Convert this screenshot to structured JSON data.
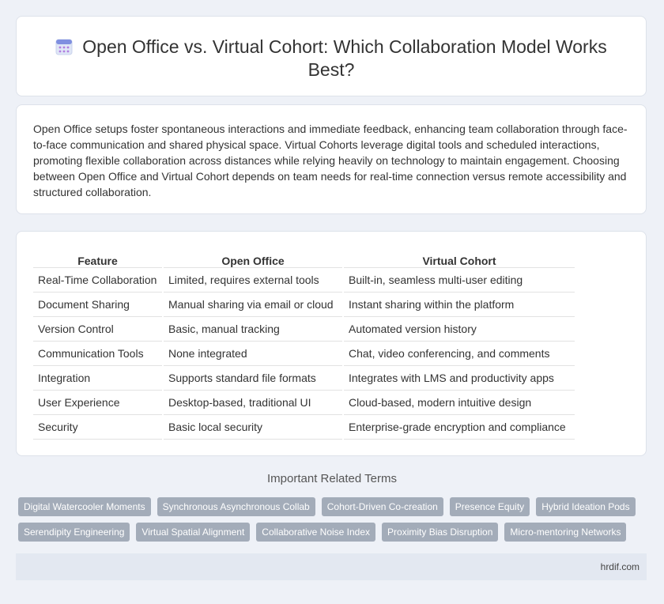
{
  "header": {
    "title": "Open Office vs. Virtual Cohort: Which Collaboration Model Works Best?",
    "icon": "calendar-icon"
  },
  "summary": "Open Office setups foster spontaneous interactions and immediate feedback, enhancing team collaboration through face-to-face communication and shared physical space. Virtual Cohorts leverage digital tools and scheduled interactions, promoting flexible collaboration across distances while relying heavily on technology to maintain engagement. Choosing between Open Office and Virtual Cohort depends on team needs for real-time connection versus remote accessibility and structured collaboration.",
  "table": {
    "headers": [
      "Feature",
      "Open Office",
      "Virtual Cohort"
    ],
    "rows": [
      [
        "Real-Time Collaboration",
        "Limited, requires external tools",
        "Built-in, seamless multi-user editing"
      ],
      [
        "Document Sharing",
        "Manual sharing via email or cloud",
        "Instant sharing within the platform"
      ],
      [
        "Version Control",
        "Basic, manual tracking",
        "Automated version history"
      ],
      [
        "Communication Tools",
        "None integrated",
        "Chat, video conferencing, and comments"
      ],
      [
        "Integration",
        "Supports standard file formats",
        "Integrates with LMS and productivity apps"
      ],
      [
        "User Experience",
        "Desktop-based, traditional UI",
        "Cloud-based, modern intuitive design"
      ],
      [
        "Security",
        "Basic local security",
        "Enterprise-grade encryption and compliance"
      ]
    ]
  },
  "related": {
    "heading": "Important Related Terms",
    "terms": [
      "Digital Watercooler Moments",
      "Synchronous Asynchronous Collab",
      "Cohort-Driven Co-creation",
      "Presence Equity",
      "Hybrid Ideation Pods",
      "Serendipity Engineering",
      "Virtual Spatial Alignment",
      "Collaborative Noise Index",
      "Proximity Bias Disruption",
      "Micro-mentoring Networks"
    ]
  },
  "footer": {
    "site": "hrdif.com"
  },
  "colors": {
    "background": "#eef1f7",
    "tag": "#a3acb9",
    "footer": "#e3e8f1"
  }
}
